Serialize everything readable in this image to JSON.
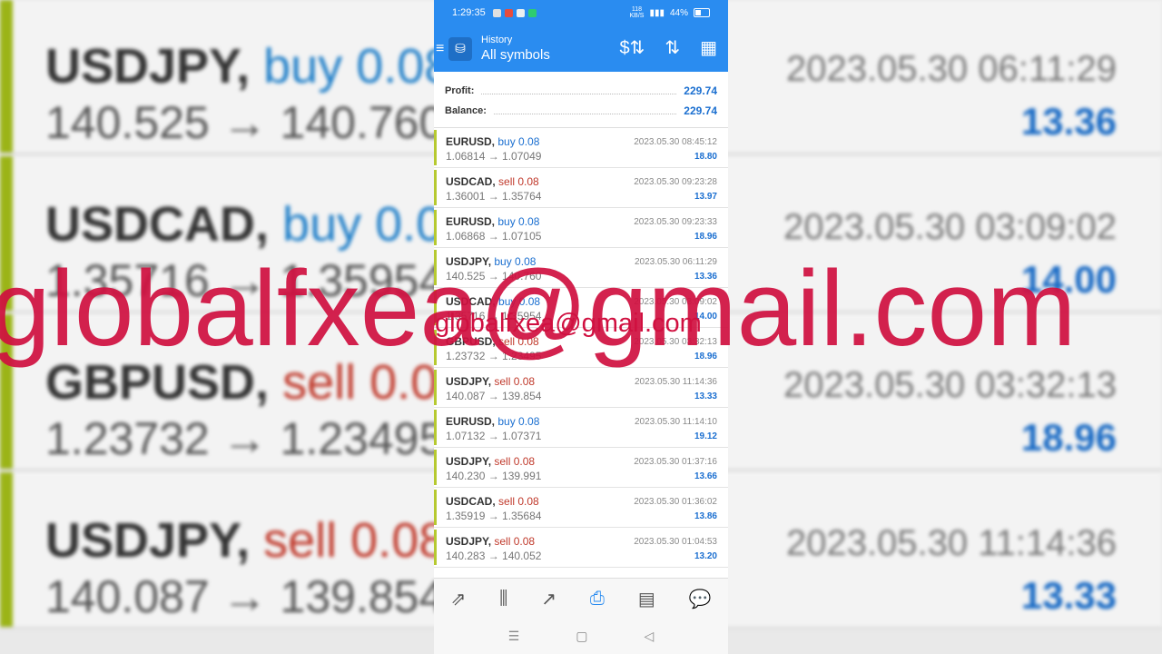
{
  "status": {
    "time": "1:29:35",
    "battery": "44%",
    "net": "118",
    "net_unit": "KB/S"
  },
  "header": {
    "title": "History",
    "subtitle": "All symbols"
  },
  "summary": {
    "profit_label": "Profit:",
    "profit_value": "229.74",
    "balance_label": "Balance:",
    "balance_value": "229.74"
  },
  "deals": [
    {
      "symbol": "EURUSD,",
      "side": "buy 0.08",
      "dir": "buy",
      "prices": "1.06814 → 1.07049",
      "time": "2023.05.30 08:45:12",
      "profit": "18.80"
    },
    {
      "symbol": "USDCAD,",
      "side": "sell 0.08",
      "dir": "sell",
      "prices": "1.36001 → 1.35764",
      "time": "2023.05.30 09:23:28",
      "profit": "13.97"
    },
    {
      "symbol": "EURUSD,",
      "side": "buy 0.08",
      "dir": "buy",
      "prices": "1.06868 → 1.07105",
      "time": "2023.05.30 09:23:33",
      "profit": "18.96"
    },
    {
      "symbol": "USDJPY,",
      "side": "buy 0.08",
      "dir": "buy",
      "prices": "140.525 → 140.760",
      "time": "2023.05.30 06:11:29",
      "profit": "13.36"
    },
    {
      "symbol": "USDCAD,",
      "side": "buy 0.08",
      "dir": "buy",
      "prices": "1.35716 → 1.35954",
      "time": "2023.05.30 03:09:02",
      "profit": "14.00"
    },
    {
      "symbol": "GBPUSD,",
      "side": "sell 0.08",
      "dir": "sell",
      "prices": "1.23732 → 1.23495",
      "time": "2023.05.30 03:32:13",
      "profit": "18.96"
    },
    {
      "symbol": "USDJPY,",
      "side": "sell 0.08",
      "dir": "sell",
      "prices": "140.087 → 139.854",
      "time": "2023.05.30 11:14:36",
      "profit": "13.33"
    },
    {
      "symbol": "EURUSD,",
      "side": "buy 0.08",
      "dir": "buy",
      "prices": "1.07132 → 1.07371",
      "time": "2023.05.30 11:14:10",
      "profit": "19.12"
    },
    {
      "symbol": "USDJPY,",
      "side": "sell 0.08",
      "dir": "sell",
      "prices": "140.230 → 139.991",
      "time": "2023.05.30 01:37:16",
      "profit": "13.66"
    },
    {
      "symbol": "USDCAD,",
      "side": "sell 0.08",
      "dir": "sell",
      "prices": "1.35919 → 1.35684",
      "time": "2023.05.30 01:36:02",
      "profit": "13.86"
    },
    {
      "symbol": "USDJPY,",
      "side": "sell 0.08",
      "dir": "sell",
      "prices": "140.283 → 140.052",
      "time": "2023.05.30 01:04:53",
      "profit": "13.20"
    }
  ],
  "background_rows": [
    {
      "symbol": "USDJPY,",
      "side": "buy 0.08",
      "dir": "buy",
      "prices": "140.525 → 140.760",
      "time": "2023.05.30 06:11:29",
      "profit": "13.36"
    },
    {
      "symbol": "USDCAD,",
      "side": "buy 0.08",
      "dir": "buy",
      "prices": "1.35716 → 1.35954",
      "time": "2023.05.30 03:09:02",
      "profit": "14.00"
    },
    {
      "symbol": "GBPUSD,",
      "side": "sell 0.08",
      "dir": "sell",
      "prices": "1.23732 → 1.23495",
      "time": "2023.05.30 03:32:13",
      "profit": "18.96"
    },
    {
      "symbol": "USDJPY,",
      "side": "sell 0.08",
      "dir": "sell",
      "prices": "140.087 → 139.854",
      "time": "2023.05.30 11:14:36",
      "profit": "13.33"
    }
  ],
  "watermark": "globalfxea@gmail.com",
  "tabs": [
    {
      "name": "quotes",
      "icon": "⇗",
      "active": false
    },
    {
      "name": "chart",
      "icon": "⫼",
      "active": false
    },
    {
      "name": "trade",
      "icon": "↗",
      "active": false
    },
    {
      "name": "history",
      "icon": "⎙",
      "active": true
    },
    {
      "name": "news",
      "icon": "▤",
      "active": false
    },
    {
      "name": "messages",
      "icon": "💬",
      "active": false
    }
  ],
  "colors": {
    "accent": "#2a8cf0",
    "buy": "#1b6fd0",
    "sell": "#c0392b",
    "watermark": "#d01040"
  }
}
